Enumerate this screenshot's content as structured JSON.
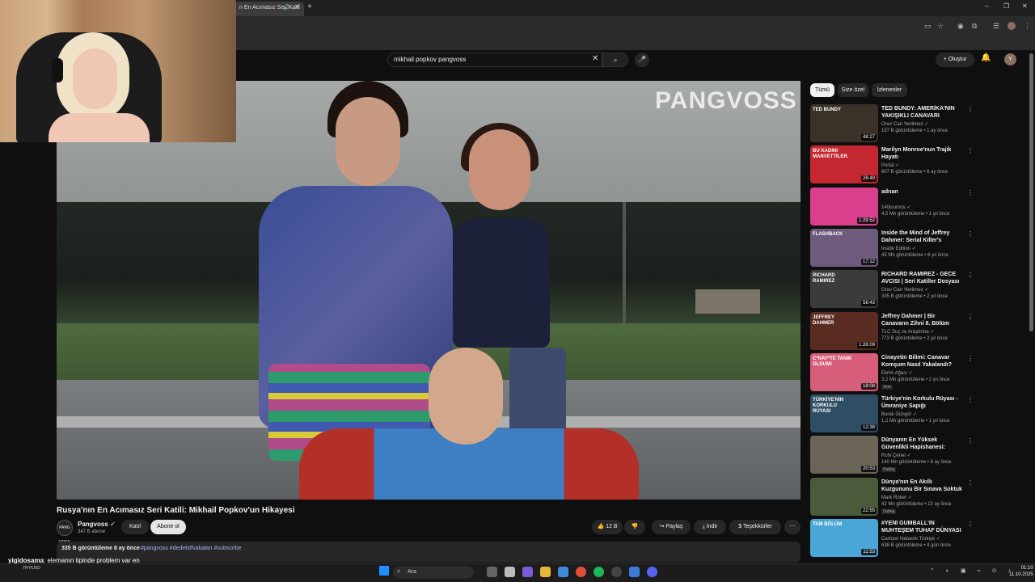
{
  "browser": {
    "tab_title": "n En Acımasız Seri Katil",
    "new_tab": "+",
    "controls": [
      "–",
      "❐",
      "✕"
    ]
  },
  "youtube": {
    "search_value": "mikhail popkov pangvoss",
    "create_label": "Oluştur",
    "avatar_letter": "Y"
  },
  "video": {
    "watermark": "PANGVOSS",
    "title": "Rusya'nın En Acımasız Seri Katili: Mikhail Popkov'un Hikayesi",
    "channel_name": "Pangvoss",
    "channel_avatar": "PANG VOSS",
    "subscribers": "347 B abone",
    "join_label": "Katıl",
    "subscribe_label": "Abone ol",
    "likes": "12 B",
    "share_label": "Paylaş",
    "download_label": "İndir",
    "thanks_label": "Teşekkürler",
    "more_label": "⋯",
    "views_date": "335 B görüntüleme  8 ay önce",
    "tags": "#pangvoss #dedektifvakaları #subscribe"
  },
  "sidebar": {
    "chips": [
      "Tümü",
      "Size özel",
      "İzlenenler"
    ],
    "items": [
      {
        "title": "TED BUNDY: AMERİKA'NIN YAKIŞIKLI CANAVARI",
        "channel": "Onur Can Yenilmez ✓",
        "meta": "157 B görüntüleme • 1 ay önce",
        "duration": "48:27",
        "thumb_color": "#3a3228",
        "thumb_text": "TED BUNDY"
      },
      {
        "title": "Marilyn Monroe'nun Trajik Hayatı",
        "channel": "Portal ✓",
        "meta": "807 B görüntüleme • 6 ay önce",
        "duration": "26:49",
        "thumb_color": "#c4272f",
        "thumb_text": "BU KADINI MANVETTİLER."
      },
      {
        "title": "adnan",
        "channel": "140journos ✓",
        "meta": "4,5 Mn görüntüleme • 1 yıl önce",
        "duration": "1:29:52",
        "thumb_color": "#d93f8c",
        "thumb_text": ""
      },
      {
        "title": "Inside the Mind of Jeffrey Dahmer: Serial Killer's Chilling ...",
        "channel": "Inside Edition ✓",
        "meta": "45 Mn görüntüleme • 6 yıl önce",
        "duration": "17:12",
        "thumb_color": "#6d5a7d",
        "thumb_text": "FLASHBACK"
      },
      {
        "title": "RICHARD RAMIREZ - GECE AVCISI | Seri Katiller Dosyası ...",
        "channel": "Onur Can Yenilmez ✓",
        "meta": "335 B görüntüleme • 2 yıl önce",
        "duration": "58:43",
        "thumb_color": "#3b3b3b",
        "thumb_text": "RICHARD RAMIREZ"
      },
      {
        "title": "Jeffrey Dahmer | Bir Canavarın Zihni 8. Bölüm",
        "channel": "TLC Suç ve Araştırma ✓",
        "meta": "773 B görüntüleme • 2 yıl önce",
        "duration": "1:28:09",
        "thumb_color": "#5a2b20",
        "thumb_text": "JEFFREY DAHMER"
      },
      {
        "title": "Cinayetin Bilimi: Canavar Komşum Nasıl Yakalandı?",
        "channel": "Ekrim Ağacı ✓",
        "meta": "3,2 Mn görüntüleme • 2 yıl önce",
        "duration": "18:08",
        "thumb_color": "#d65e7a",
        "thumb_text": "C*NAY*TE TANIK OLDUM!",
        "badge": "Yeni"
      },
      {
        "title": "Türkiye'nin Korkulu Rüyası - Ümraniye Sapığı",
        "channel": "Burak Güngör ✓",
        "meta": "1,2 Mn görüntüleme • 1 yıl önce",
        "duration": "12:38",
        "thumb_color": "#2f4e63",
        "thumb_text": "TÜRKİYE'NİN KORKULU RÜYASI"
      },
      {
        "title": "Dünyanın En Yüksek Güvenlikli Hapishanesi: CECOT (Şeytanla...",
        "channel": "Ruhi Çenet ✓",
        "meta": "140 Mn görüntüleme • 8 ay önce",
        "duration": "20:53",
        "thumb_color": "#6b6558",
        "thumb_text": "",
        "badge": "Dublaj"
      },
      {
        "title": "Dünya'nın En Akıllı Kuzgununu Bir Sınava Soktuk",
        "channel": "Mark Rober ✓",
        "meta": "42 Mn görüntüleme • 10 ay önce",
        "duration": "22:55",
        "thumb_color": "#4a5a3a",
        "thumb_text": "",
        "badge": "Dublaj"
      },
      {
        "title": "#YENİ GUMBALL'IN MUHTEŞEM TUHAF DÜNYASI | ...",
        "channel": "Cartoon Network Türkiye ✓",
        "meta": "638 B görüntüleme • 4 gün önce",
        "duration": "11:53",
        "thumb_color": "#4aa6d6",
        "thumb_text": "TAM BÖLÜM"
      }
    ]
  },
  "chat": {
    "user": "yigidosama",
    "message": ": elemanın tipinde problem var en",
    "prev": "basta"
  },
  "taskbar": {
    "search_placeholder": "Ara",
    "time": "01:10",
    "date": "11.10.2025",
    "weather": "TRY/USD"
  }
}
